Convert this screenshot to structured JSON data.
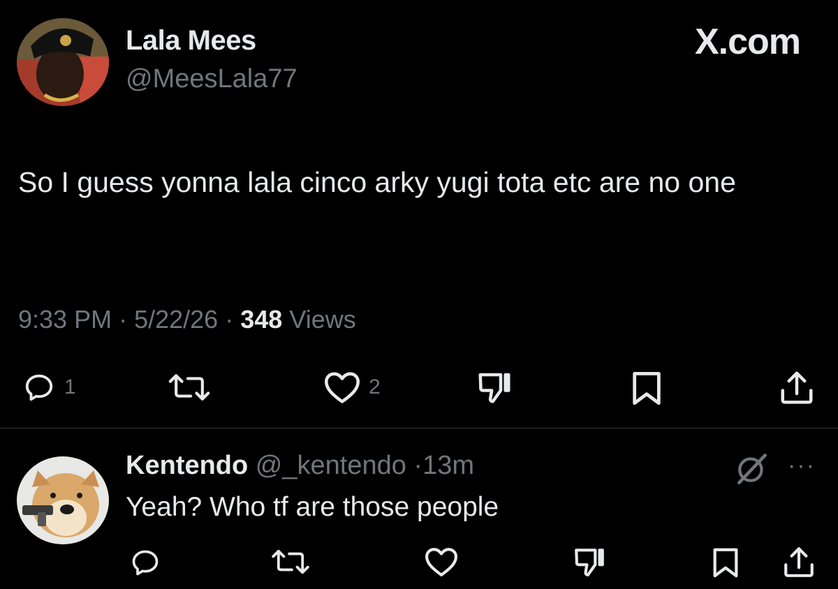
{
  "post": {
    "author_name": "Lala Mees",
    "author_handle": "@MeesLala77",
    "brand": "X.com",
    "text": "So I guess yonna lala cinco arky yugi tota etc are no one",
    "time": "9:33 PM",
    "date": "5/22/26",
    "views_count": "348",
    "views_label": "Views",
    "actions": {
      "reply_count": "1",
      "repost_count": "",
      "like_count": "2"
    }
  },
  "reply": {
    "author_name": "Kentendo",
    "author_handle": "@_kentendo",
    "age": "13m",
    "text": "Yeah? Who tf are those people",
    "more_label": "···"
  },
  "colors": {
    "background": "#000000",
    "text_primary": "#e7e9ea",
    "text_secondary": "#71767b",
    "divider": "#2f3336"
  },
  "icons": [
    "reply-icon",
    "repost-icon",
    "like-icon",
    "dislike-icon",
    "bookmark-icon",
    "share-icon",
    "grok-icon",
    "more-icon"
  ]
}
